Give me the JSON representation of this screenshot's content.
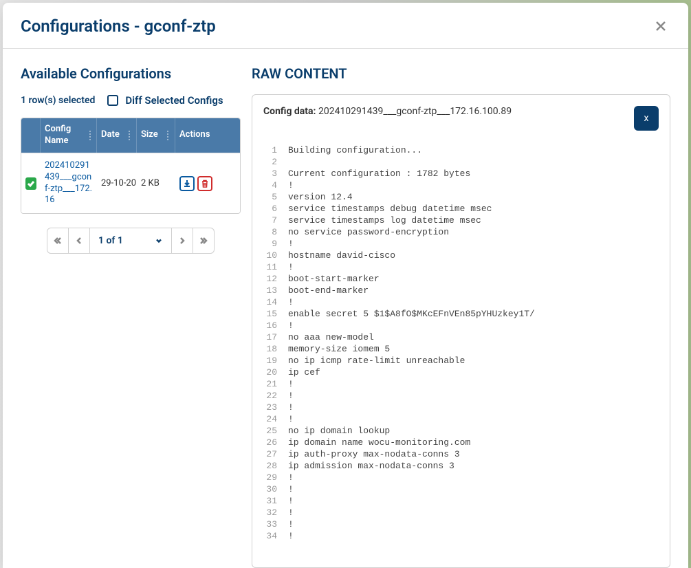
{
  "modal": {
    "title": "Configurations - gconf-ztp"
  },
  "left": {
    "title": "Available Configurations",
    "selected_text": "1 row(s) selected",
    "diff_label": "Diff Selected Configs",
    "columns": {
      "name": "Config Name",
      "date": "Date",
      "size": "Size",
      "actions": "Actions"
    },
    "rows": [
      {
        "name": "202410291439___gconf-ztp___172.16",
        "date": "29-10-20",
        "size": "2 KB"
      }
    ],
    "pagination": {
      "label": "1 of 1"
    }
  },
  "right": {
    "title": "RAW CONTENT",
    "config_label": "Config data:",
    "config_value": "202410291439___gconf-ztp___172.16.100.89",
    "close_x": "x",
    "code": [
      "Building configuration...",
      "",
      "Current configuration : 1782 bytes",
      "!",
      "version 12.4",
      "service timestamps debug datetime msec",
      "service timestamps log datetime msec",
      "no service password-encryption",
      "!",
      "hostname david-cisco",
      "!",
      "boot-start-marker",
      "boot-end-marker",
      "!",
      "enable secret 5 $1$A8fO$MKcEFnVEn85pYHUzkey1T/",
      "!",
      "no aaa new-model",
      "memory-size iomem 5",
      "no ip icmp rate-limit unreachable",
      "ip cef",
      "!",
      "!",
      "!",
      "!",
      "no ip domain lookup",
      "ip domain name wocu-monitoring.com",
      "ip auth-proxy max-nodata-conns 3",
      "ip admission max-nodata-conns 3",
      "!",
      "!",
      "!",
      "!",
      "!",
      "!"
    ]
  }
}
